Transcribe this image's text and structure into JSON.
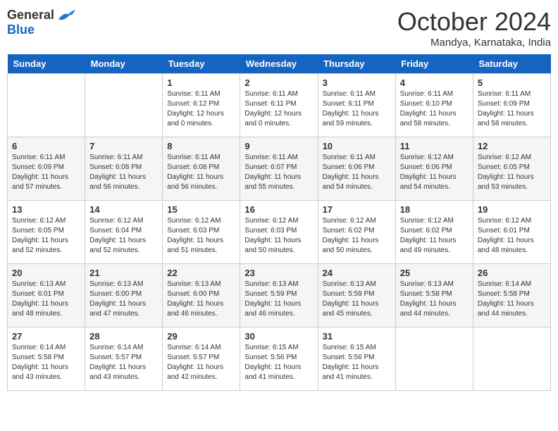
{
  "header": {
    "logo_general": "General",
    "logo_blue": "Blue",
    "month": "October 2024",
    "location": "Mandya, Karnataka, India"
  },
  "days_of_week": [
    "Sunday",
    "Monday",
    "Tuesday",
    "Wednesday",
    "Thursday",
    "Friday",
    "Saturday"
  ],
  "weeks": [
    [
      {
        "day": "",
        "info": ""
      },
      {
        "day": "",
        "info": ""
      },
      {
        "day": "1",
        "info": "Sunrise: 6:11 AM\nSunset: 6:12 PM\nDaylight: 12 hours\nand 0 minutes."
      },
      {
        "day": "2",
        "info": "Sunrise: 6:11 AM\nSunset: 6:11 PM\nDaylight: 12 hours\nand 0 minutes."
      },
      {
        "day": "3",
        "info": "Sunrise: 6:11 AM\nSunset: 6:11 PM\nDaylight: 11 hours\nand 59 minutes."
      },
      {
        "day": "4",
        "info": "Sunrise: 6:11 AM\nSunset: 6:10 PM\nDaylight: 11 hours\nand 58 minutes."
      },
      {
        "day": "5",
        "info": "Sunrise: 6:11 AM\nSunset: 6:09 PM\nDaylight: 11 hours\nand 58 minutes."
      }
    ],
    [
      {
        "day": "6",
        "info": "Sunrise: 6:11 AM\nSunset: 6:09 PM\nDaylight: 11 hours\nand 57 minutes."
      },
      {
        "day": "7",
        "info": "Sunrise: 6:11 AM\nSunset: 6:08 PM\nDaylight: 11 hours\nand 56 minutes."
      },
      {
        "day": "8",
        "info": "Sunrise: 6:11 AM\nSunset: 6:08 PM\nDaylight: 11 hours\nand 56 minutes."
      },
      {
        "day": "9",
        "info": "Sunrise: 6:11 AM\nSunset: 6:07 PM\nDaylight: 11 hours\nand 55 minutes."
      },
      {
        "day": "10",
        "info": "Sunrise: 6:11 AM\nSunset: 6:06 PM\nDaylight: 11 hours\nand 54 minutes."
      },
      {
        "day": "11",
        "info": "Sunrise: 6:12 AM\nSunset: 6:06 PM\nDaylight: 11 hours\nand 54 minutes."
      },
      {
        "day": "12",
        "info": "Sunrise: 6:12 AM\nSunset: 6:05 PM\nDaylight: 11 hours\nand 53 minutes."
      }
    ],
    [
      {
        "day": "13",
        "info": "Sunrise: 6:12 AM\nSunset: 6:05 PM\nDaylight: 11 hours\nand 52 minutes."
      },
      {
        "day": "14",
        "info": "Sunrise: 6:12 AM\nSunset: 6:04 PM\nDaylight: 11 hours\nand 52 minutes."
      },
      {
        "day": "15",
        "info": "Sunrise: 6:12 AM\nSunset: 6:03 PM\nDaylight: 11 hours\nand 51 minutes."
      },
      {
        "day": "16",
        "info": "Sunrise: 6:12 AM\nSunset: 6:03 PM\nDaylight: 11 hours\nand 50 minutes."
      },
      {
        "day": "17",
        "info": "Sunrise: 6:12 AM\nSunset: 6:02 PM\nDaylight: 11 hours\nand 50 minutes."
      },
      {
        "day": "18",
        "info": "Sunrise: 6:12 AM\nSunset: 6:02 PM\nDaylight: 11 hours\nand 49 minutes."
      },
      {
        "day": "19",
        "info": "Sunrise: 6:12 AM\nSunset: 6:01 PM\nDaylight: 11 hours\nand 48 minutes."
      }
    ],
    [
      {
        "day": "20",
        "info": "Sunrise: 6:13 AM\nSunset: 6:01 PM\nDaylight: 11 hours\nand 48 minutes."
      },
      {
        "day": "21",
        "info": "Sunrise: 6:13 AM\nSunset: 6:00 PM\nDaylight: 11 hours\nand 47 minutes."
      },
      {
        "day": "22",
        "info": "Sunrise: 6:13 AM\nSunset: 6:00 PM\nDaylight: 11 hours\nand 46 minutes."
      },
      {
        "day": "23",
        "info": "Sunrise: 6:13 AM\nSunset: 5:59 PM\nDaylight: 11 hours\nand 46 minutes."
      },
      {
        "day": "24",
        "info": "Sunrise: 6:13 AM\nSunset: 5:59 PM\nDaylight: 11 hours\nand 45 minutes."
      },
      {
        "day": "25",
        "info": "Sunrise: 6:13 AM\nSunset: 5:58 PM\nDaylight: 11 hours\nand 44 minutes."
      },
      {
        "day": "26",
        "info": "Sunrise: 6:14 AM\nSunset: 5:58 PM\nDaylight: 11 hours\nand 44 minutes."
      }
    ],
    [
      {
        "day": "27",
        "info": "Sunrise: 6:14 AM\nSunset: 5:58 PM\nDaylight: 11 hours\nand 43 minutes."
      },
      {
        "day": "28",
        "info": "Sunrise: 6:14 AM\nSunset: 5:57 PM\nDaylight: 11 hours\nand 43 minutes."
      },
      {
        "day": "29",
        "info": "Sunrise: 6:14 AM\nSunset: 5:57 PM\nDaylight: 11 hours\nand 42 minutes."
      },
      {
        "day": "30",
        "info": "Sunrise: 6:15 AM\nSunset: 5:56 PM\nDaylight: 11 hours\nand 41 minutes."
      },
      {
        "day": "31",
        "info": "Sunrise: 6:15 AM\nSunset: 5:56 PM\nDaylight: 11 hours\nand 41 minutes."
      },
      {
        "day": "",
        "info": ""
      },
      {
        "day": "",
        "info": ""
      }
    ]
  ]
}
